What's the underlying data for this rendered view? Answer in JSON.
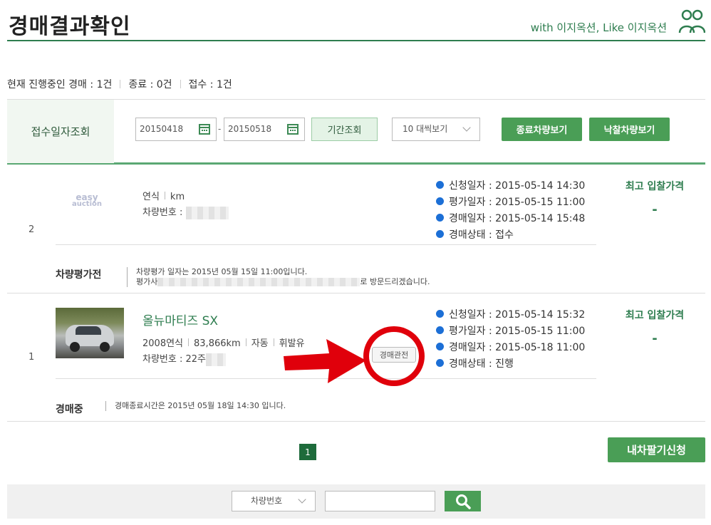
{
  "header": {
    "title": "경매결과확인",
    "slogan": "with 이지옥션, Like 이지옥션",
    "icon": "people-icon"
  },
  "summary": {
    "in_progress_label": "현재 진행중인 경매 :",
    "in_progress_count": "1건",
    "ended_label": "종료 :",
    "ended_count": "0건",
    "received_label": "접수 :",
    "received_count": "1건"
  },
  "filter": {
    "label": "접수일자조회",
    "date_from": "20150418",
    "date_to": "20150518",
    "dash": "-",
    "period_button": "기간조회",
    "view_select": "10 대씩보기",
    "ended_button": "종료차량보기",
    "won_button": "낙찰차량보기"
  },
  "rows": [
    {
      "num": "2",
      "logo_text": "easy auction",
      "specs_year": "연식",
      "specs_km": "km",
      "plate_label": "차량번호 :",
      "status": [
        {
          "label": "신청일자 : 2015-05-14 14:30"
        },
        {
          "label": "평가일자 : 2015-05-15 11:00"
        },
        {
          "label": "경매일자 : 2015-05-14 15:48"
        },
        {
          "label": "경매상태 : 접수"
        }
      ],
      "bid_label": "최고 입찰가격",
      "bid_value": "-",
      "sub_title": "차량평가전",
      "note_line1": "차량평가 일자는 2015년 05월 15일 11:00입니다.",
      "note_line2_prefix": "평가사",
      "note_line2_suffix": "로 방문드리겠습니다."
    },
    {
      "num": "1",
      "car_name": "올뉴마티즈 SX",
      "specs": [
        "2008연식",
        "83,866km",
        "자동",
        "휘발유"
      ],
      "plate_label": "차량번호 : 22주",
      "watch_button": "경매관전",
      "status": [
        {
          "label": "신청일자 : 2015-05-14 15:32"
        },
        {
          "label": "평가일자 : 2015-05-15 11:00"
        },
        {
          "label": "경매일자 : 2015-05-18 11:00"
        },
        {
          "label": "경매상태 : 진행"
        }
      ],
      "bid_label": "최고 입찰가격",
      "bid_value": "-",
      "sub_title": "경매중",
      "note": "경매종료시간은 2015년 05월 18일 14:30 입니다."
    }
  ],
  "pagination": {
    "current": "1"
  },
  "sell_button": "내차팔기신청",
  "search": {
    "select": "차량번호",
    "input_value": "",
    "button_icon": "search-icon"
  },
  "colors": {
    "brand_green": "#2e7d4f",
    "button_green": "#4a9e56",
    "status_dot": "#1c6fd6",
    "annotation_red": "#e0000b"
  }
}
